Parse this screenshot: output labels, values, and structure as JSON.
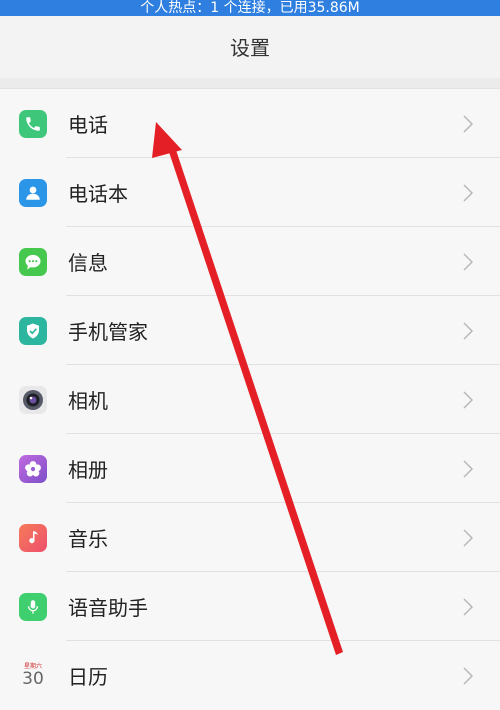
{
  "status_bar": {
    "text": "个人热点：1 个连接，已用35.86M"
  },
  "header": {
    "title": "设置"
  },
  "settings_list": [
    {
      "label": "电话",
      "icon": "phone-icon",
      "color": "#3ec77a"
    },
    {
      "label": "电话本",
      "icon": "contacts-icon",
      "color": "#2b95e8"
    },
    {
      "label": "信息",
      "icon": "message-icon",
      "color": "#46c84e"
    },
    {
      "label": "手机管家",
      "icon": "shield-icon",
      "color": "#2cb6a0"
    },
    {
      "label": "相机",
      "icon": "camera-icon",
      "color": "#555a66"
    },
    {
      "label": "相册",
      "icon": "flower-icon",
      "color": "#9a5fd1"
    },
    {
      "label": "音乐",
      "icon": "music-icon",
      "color": "#f0655a"
    },
    {
      "label": "语音助手",
      "icon": "microphone-icon",
      "color": "#3fcf6e"
    },
    {
      "label": "日历",
      "icon": "calendar-icon",
      "color": "#d23030"
    }
  ],
  "calendar_icon": {
    "top": "星期六",
    "day": "30"
  },
  "annotation": {
    "arrow_color": "#e42026"
  }
}
